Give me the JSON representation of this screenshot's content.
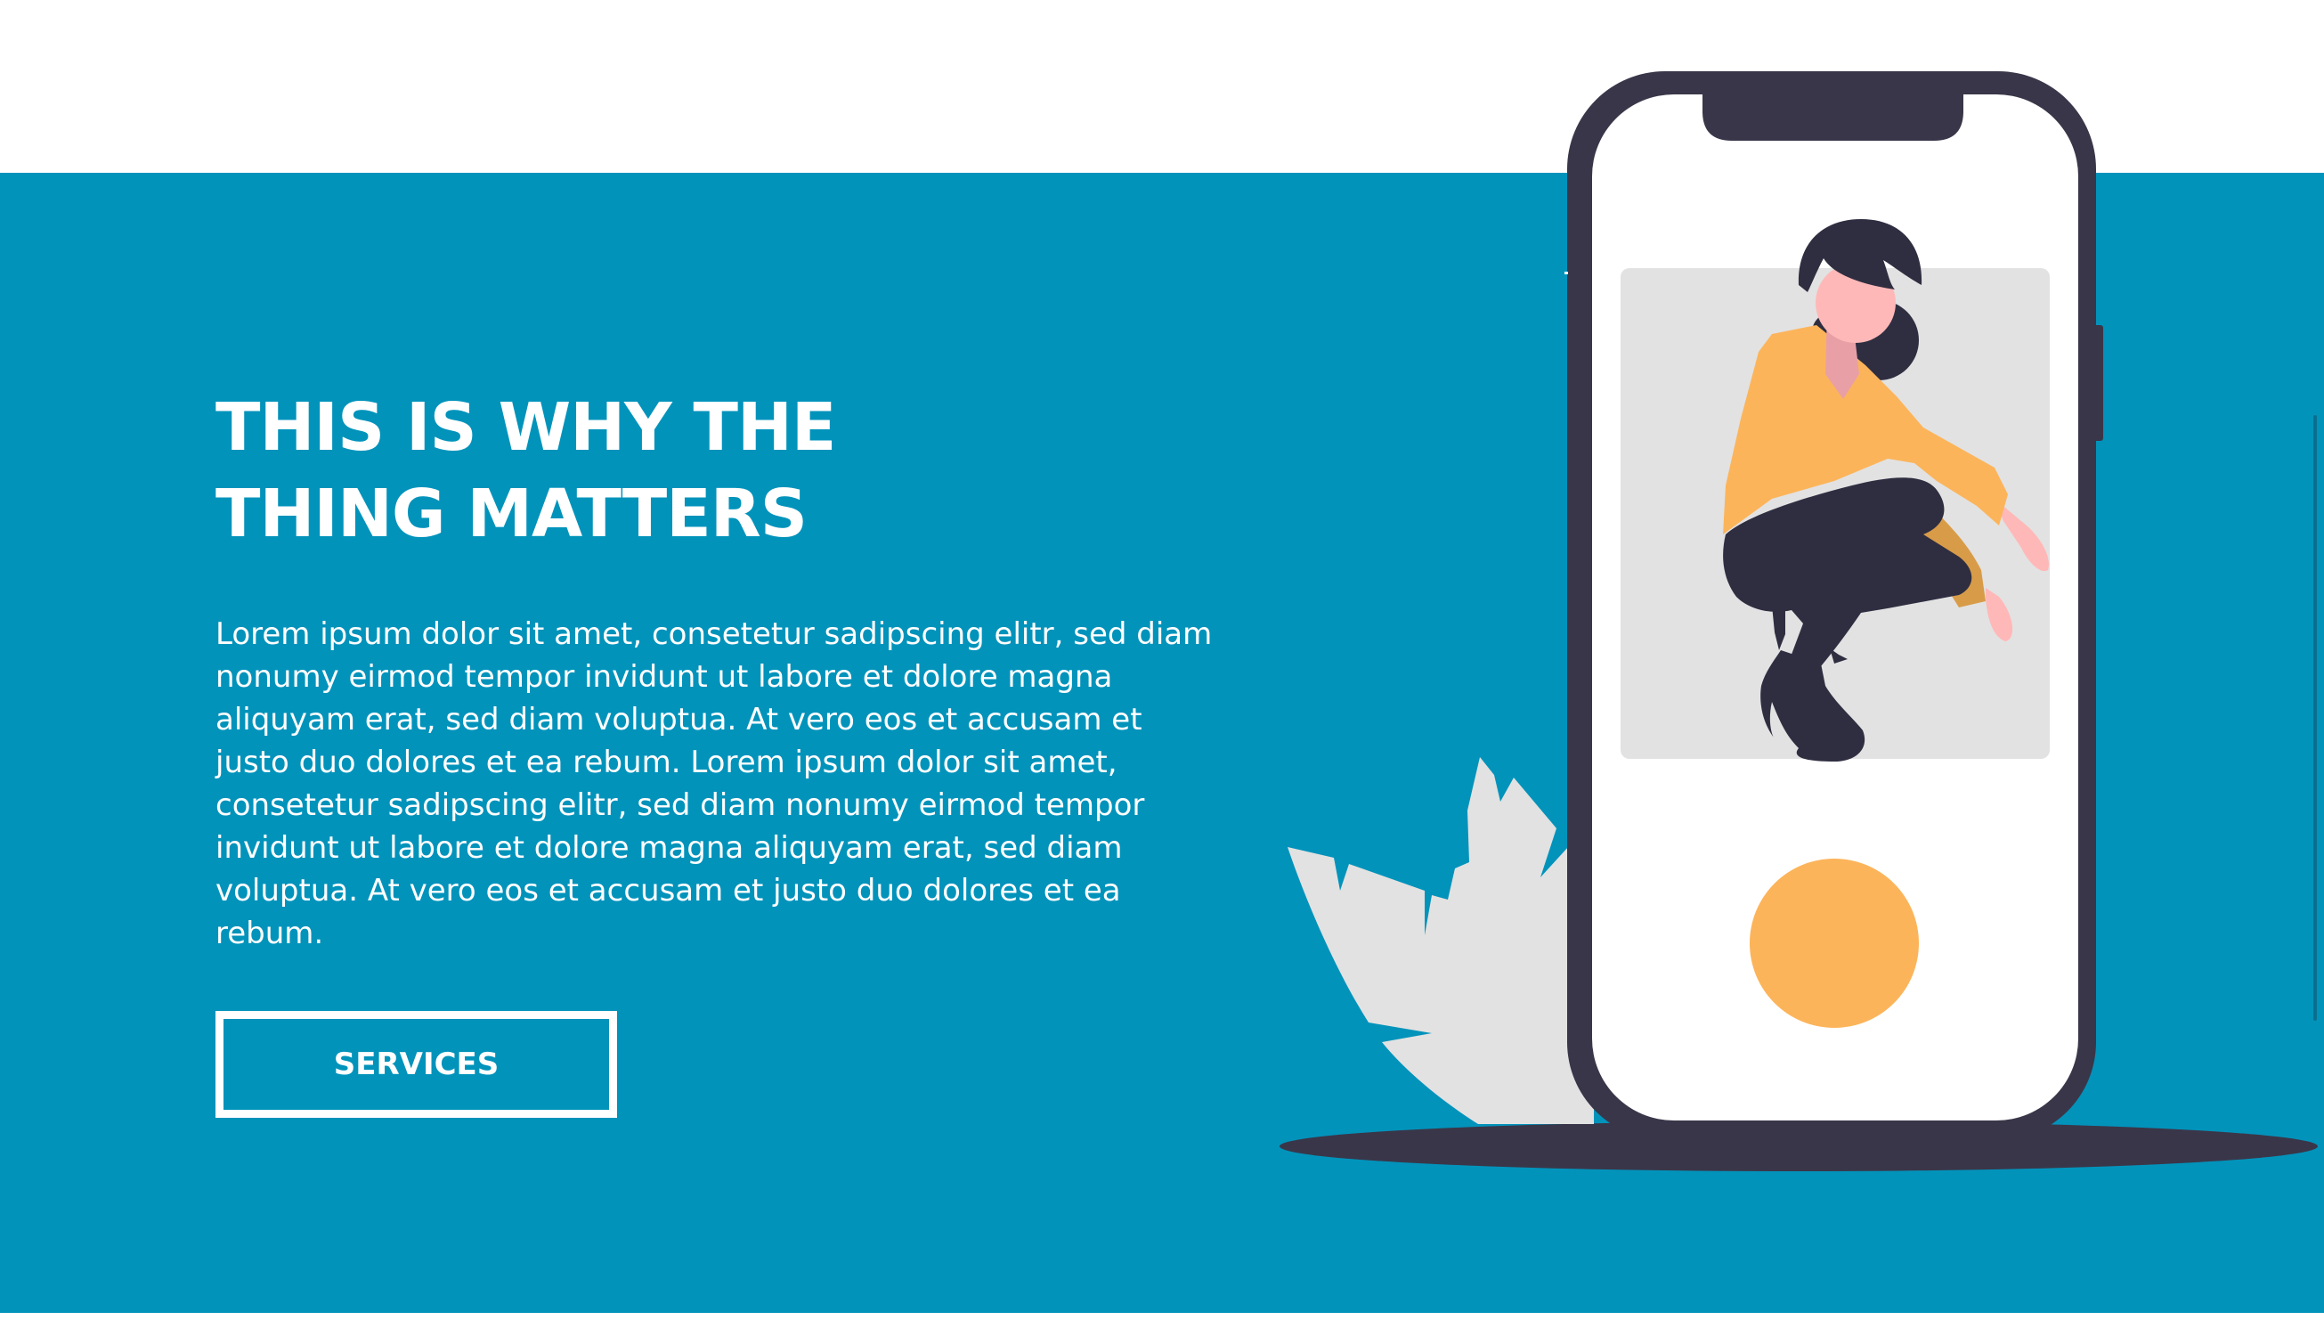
{
  "hero": {
    "headline_line1": "THIS IS WHY THE",
    "headline_line2": "THING MATTERS",
    "body_lines": [
      "Lorem ipsum dolor sit amet, consetetur sadipscing elitr, sed diam",
      "nonumy eirmod tempor invidunt ut labore et dolore magna",
      "aliquyam erat, sed diam voluptua. At vero eos et accusam et",
      "justo duo dolores et ea rebum. Lorem ipsum dolor sit amet,",
      "consetetur sadipscing elitr, sed diam nonumy eirmod tempor",
      "invidunt ut labore et dolore magna aliquyam erat, sed diam",
      "voluptua. At vero eos et accusam et justo duo dolores et ea",
      "rebum."
    ],
    "button_label": "SERVICES"
  },
  "colors": {
    "hero_background": "#0293bb",
    "phone_frame": "#3a3649",
    "accent_yellow": "#fcb45a",
    "leaf_gray": "#e2e2e2",
    "skin_pink": "#ffb8b8"
  },
  "illustration": {
    "icon": "woman-on-phone-illustration"
  }
}
